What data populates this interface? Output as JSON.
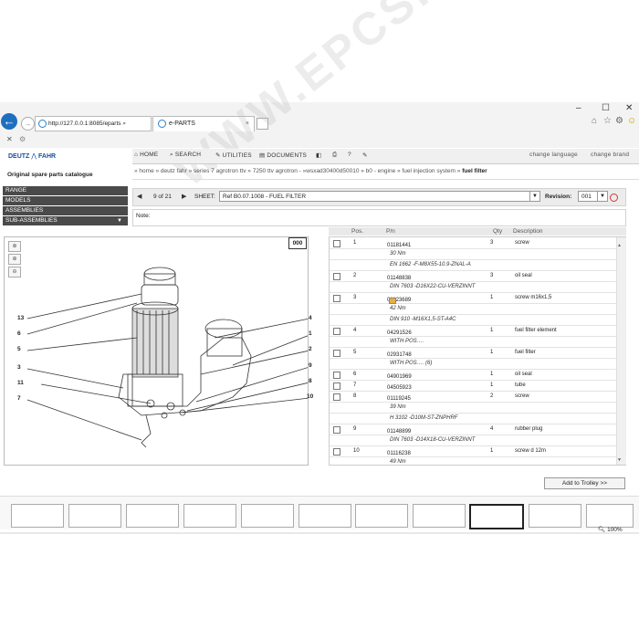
{
  "browser": {
    "address": "http://127.0.0.1:8085/eparts",
    "tab_title": "e-PARTS",
    "tab_close": "×",
    "window_min": "–",
    "window_max": "☐",
    "window_close": "✕",
    "toolbar_icons": [
      "home-icon",
      "star-icon",
      "gear-icon",
      "smiley-icon"
    ],
    "zoom": "100%"
  },
  "app": {
    "logo_left": "DEUTZ",
    "logo_right": "FAHR",
    "catalogue_title": "Original spare parts catalogue",
    "nav": {
      "home": "HOME",
      "search": "SEARCH",
      "utilities": "UTILITIES",
      "documents": "DOCUMENTS",
      "change_language": "change language",
      "change_brand": "change brand"
    },
    "breadcrumb": {
      "path": "» home » deutz fahr » series 7 agrotron ttv » 7250 ttv agrotron - »wsxad30400d50010 » b0 - engine » fuel injection system »",
      "current": "fuel filter"
    },
    "sidebar": [
      {
        "label": "RANGE"
      },
      {
        "label": "MODELS"
      },
      {
        "label": "ASSEMBLIES"
      },
      {
        "label": "SUB-ASSEMBLIES"
      }
    ],
    "toolbar": {
      "page": "9 of 21",
      "sheet_label": "SHEET:",
      "sheet_value": "Ref  B0.07.1008 - FUEL FILTER",
      "revision_label": "Revision:",
      "revision_value": "001"
    },
    "note_label": "Note:",
    "drawing": {
      "code": "000",
      "callouts": [
        "13",
        "6",
        "5",
        "3",
        "11",
        "7",
        "4",
        "1",
        "2",
        "9",
        "8",
        "10"
      ]
    },
    "table": {
      "headers": {
        "pos": "Pos.",
        "pin": "P/n",
        "qty": "Qty",
        "desc": "Description"
      },
      "rows": [
        {
          "type": "part",
          "pos": "1",
          "pin": "01181441",
          "qty": "3",
          "desc": "screw"
        },
        {
          "type": "note",
          "text": "30 Nm"
        },
        {
          "type": "note",
          "text": "EN 1662 -F-M8X55-10.9-ZNAL-A"
        },
        {
          "type": "part",
          "pos": "2",
          "pin": "01148838",
          "qty": "3",
          "desc": "oil seal"
        },
        {
          "type": "note",
          "text": "DIN 7603 -D16X22-CU-VERZINNT"
        },
        {
          "type": "part",
          "pos": "3",
          "pin": "01123689",
          "qty": "1",
          "desc": "screw m16x1,5",
          "badge": true
        },
        {
          "type": "note",
          "text": "42 Nm"
        },
        {
          "type": "note",
          "text": "DIN 910 -M16X1,5-ST-A4C"
        },
        {
          "type": "part",
          "pos": "4",
          "pin": "04291526",
          "qty": "1",
          "desc": "fuel filter element"
        },
        {
          "type": "note",
          "text": "WITH POS.…"
        },
        {
          "type": "part",
          "pos": "5",
          "pin": "02931748",
          "qty": "1",
          "desc": "fuel filter"
        },
        {
          "type": "note",
          "text": "WITH POS.… (6)"
        },
        {
          "type": "part",
          "pos": "6",
          "pin": "04901969",
          "qty": "1",
          "desc": "oil seal"
        },
        {
          "type": "part",
          "pos": "7",
          "pin": "04505923",
          "qty": "1",
          "desc": "tube"
        },
        {
          "type": "part",
          "pos": "8",
          "pin": "01119245",
          "qty": "2",
          "desc": "screw"
        },
        {
          "type": "note",
          "text": "39 Nm"
        },
        {
          "type": "note",
          "text": "H 3102 -D10M-ST-ZNPHRF"
        },
        {
          "type": "part",
          "pos": "9",
          "pin": "01148899",
          "qty": "4",
          "desc": "rubber plug"
        },
        {
          "type": "note",
          "text": "DIN 7603 -D14X18-CU-VERZINNT"
        },
        {
          "type": "part",
          "pos": "10",
          "pin": "01116238",
          "qty": "1",
          "desc": "screw d 12m"
        },
        {
          "type": "note",
          "text": "49 Nm"
        }
      ]
    },
    "add_to_trolley": "Add to Trolley >>",
    "watermark": "WWW.EPCSHOP.COM"
  }
}
